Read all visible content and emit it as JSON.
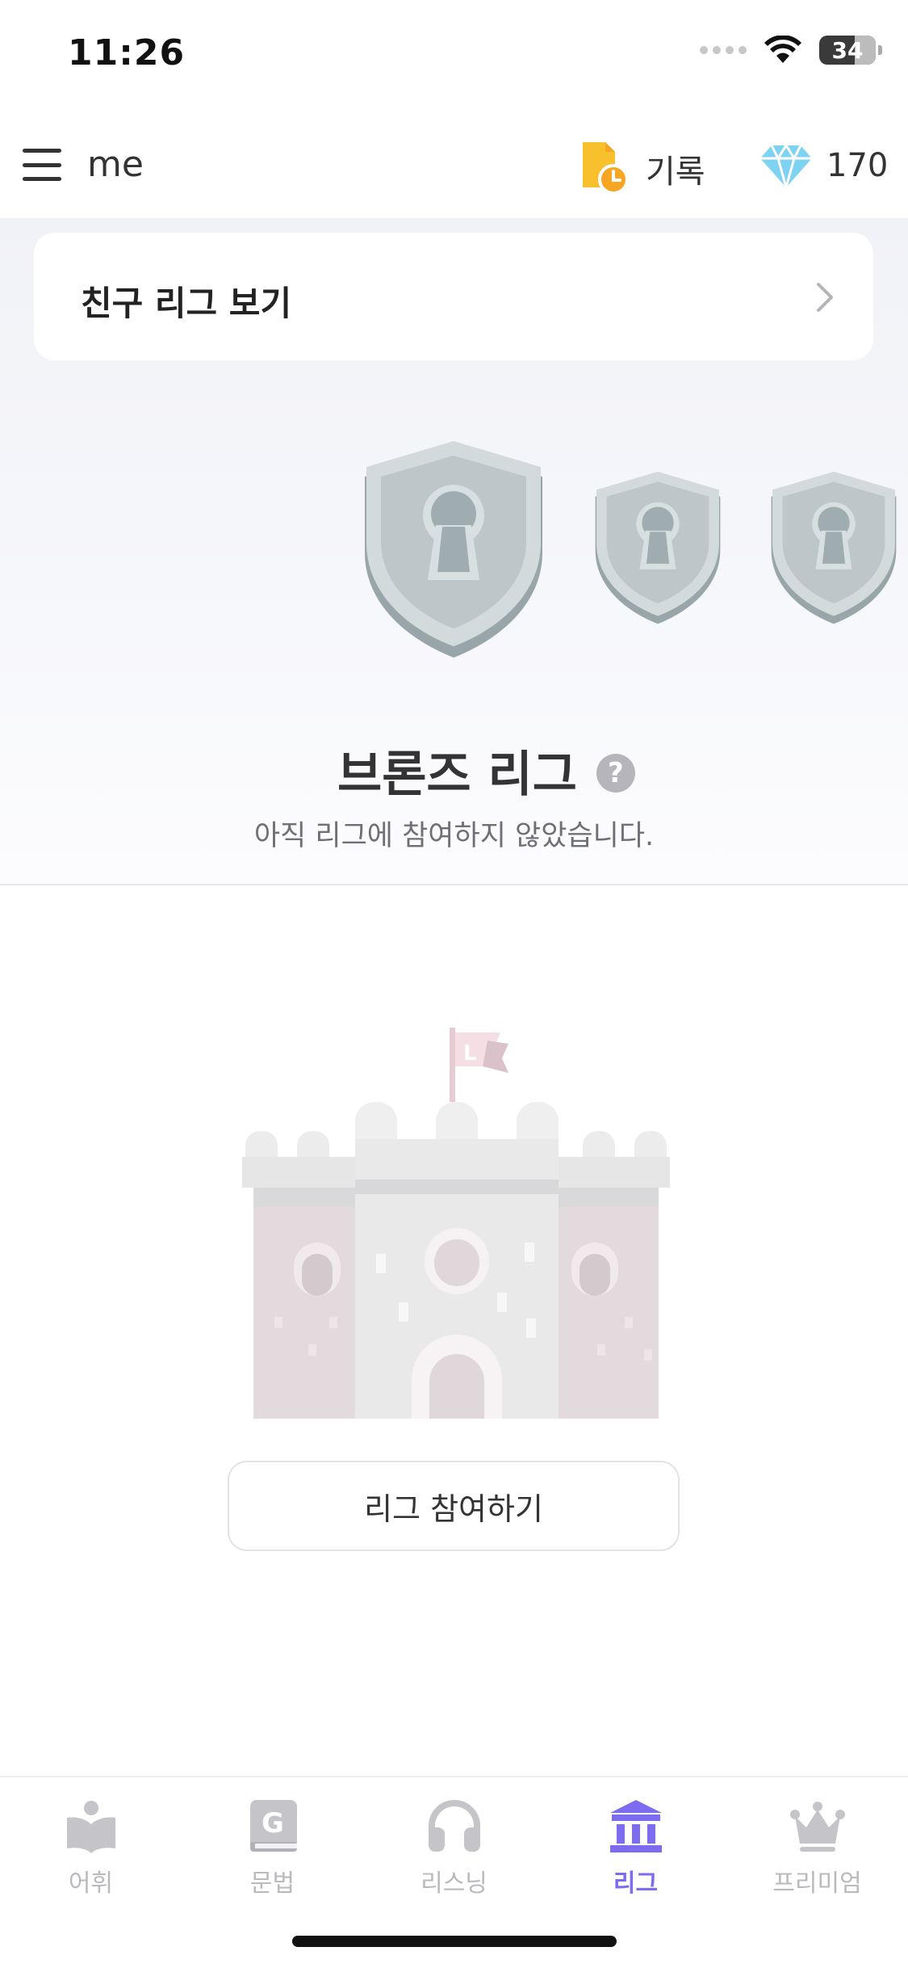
{
  "status_bar": {
    "time": "11:26",
    "battery_level": "34"
  },
  "header": {
    "user_name": "me",
    "record_label": "기록",
    "gem_count": "170"
  },
  "friend_league_card": {
    "label": "친구 리그 보기"
  },
  "league": {
    "title": "브론즈 리그",
    "help_symbol": "?",
    "subtitle": "아직 리그에 참여하지 않았습니다."
  },
  "castle_flag_letter": "L",
  "join_button": {
    "label": "리그 참여하기"
  },
  "tabs": [
    {
      "label": "어휘",
      "icon": "book-icon",
      "active": false
    },
    {
      "label": "문법",
      "icon": "grammar-book-icon",
      "active": false
    },
    {
      "label": "리스닝",
      "icon": "headphones-icon",
      "active": false
    },
    {
      "label": "리그",
      "icon": "league-building-icon",
      "active": true
    },
    {
      "label": "프리미엄",
      "icon": "crown-icon",
      "active": false
    }
  ],
  "colors": {
    "accent": "#7b6cf0",
    "inactive_tab": "#b9b9bf",
    "record_icon": "#f9c02d",
    "gem": "#7fd3f2"
  }
}
